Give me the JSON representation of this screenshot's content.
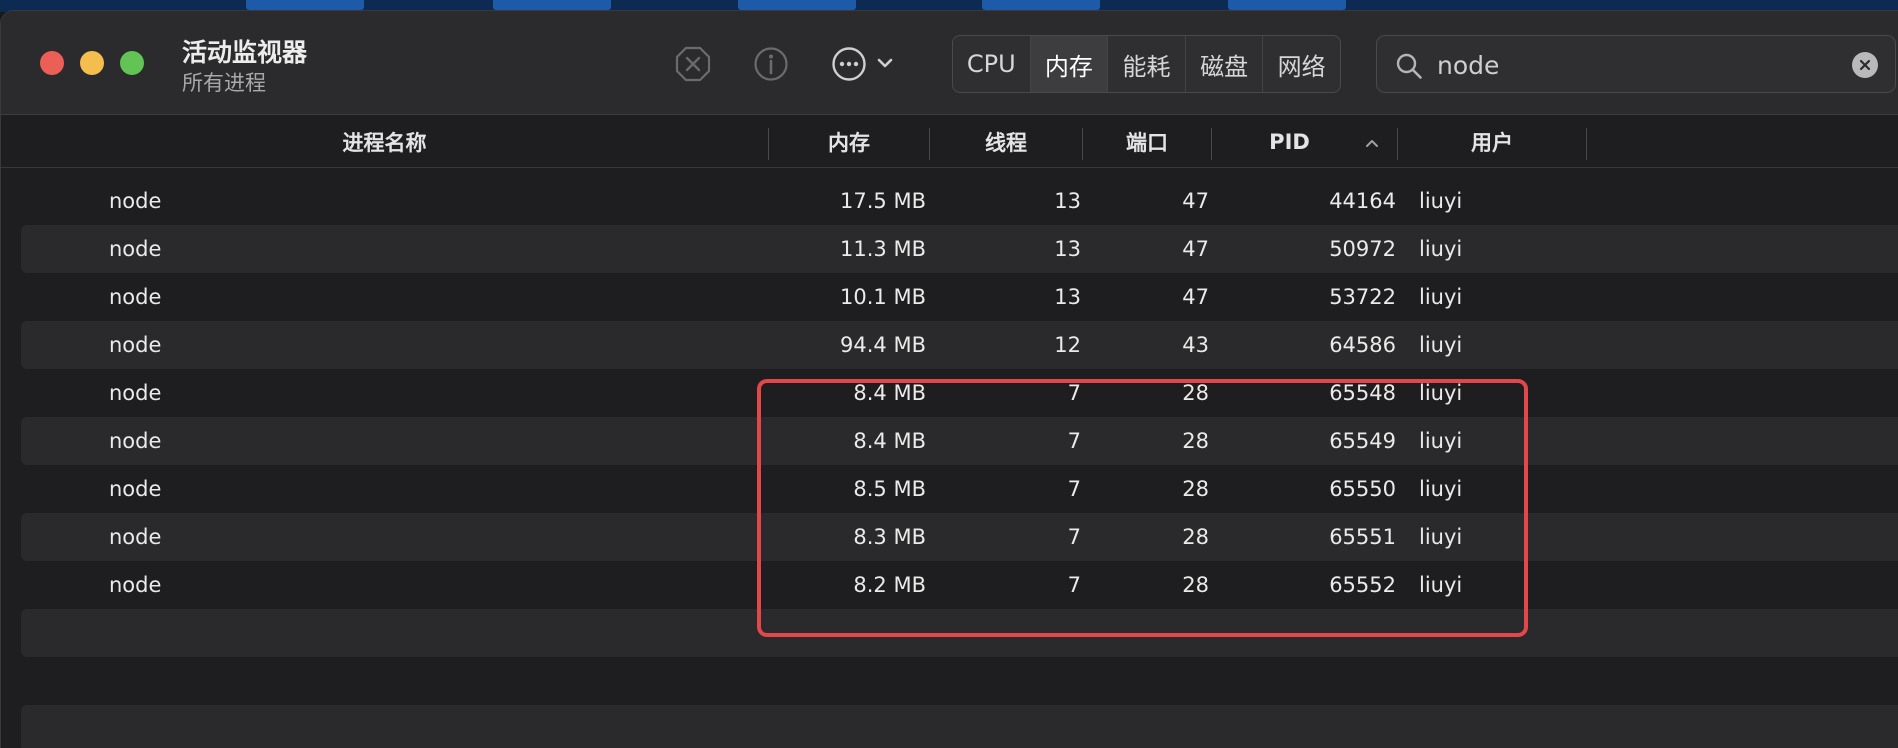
{
  "window": {
    "title": "活动监视器",
    "subtitle": "所有进程"
  },
  "toolbar": {
    "tabs": [
      {
        "label": "CPU"
      },
      {
        "label": "内存"
      },
      {
        "label": "能耗"
      },
      {
        "label": "磁盘"
      },
      {
        "label": "网络"
      }
    ],
    "active_tab": "内存",
    "search_value": "node"
  },
  "table": {
    "columns": [
      "进程名称",
      "内存",
      "线程",
      "端口",
      "PID",
      "用户"
    ],
    "sort_column": "PID",
    "sort_direction": "ascending",
    "rows": [
      {
        "name": "node",
        "memory": "17.5 MB",
        "threads": "13",
        "ports": "47",
        "pid": "44164",
        "user": "liuyi"
      },
      {
        "name": "node",
        "memory": "11.3 MB",
        "threads": "13",
        "ports": "47",
        "pid": "50972",
        "user": "liuyi"
      },
      {
        "name": "node",
        "memory": "10.1 MB",
        "threads": "13",
        "ports": "47",
        "pid": "53722",
        "user": "liuyi"
      },
      {
        "name": "node",
        "memory": "94.4 MB",
        "threads": "12",
        "ports": "43",
        "pid": "64586",
        "user": "liuyi"
      },
      {
        "name": "node",
        "memory": "8.4 MB",
        "threads": "7",
        "ports": "28",
        "pid": "65548",
        "user": "liuyi"
      },
      {
        "name": "node",
        "memory": "8.4 MB",
        "threads": "7",
        "ports": "28",
        "pid": "65549",
        "user": "liuyi"
      },
      {
        "name": "node",
        "memory": "8.5 MB",
        "threads": "7",
        "ports": "28",
        "pid": "65550",
        "user": "liuyi"
      },
      {
        "name": "node",
        "memory": "8.3 MB",
        "threads": "7",
        "ports": "28",
        "pid": "65551",
        "user": "liuyi"
      },
      {
        "name": "node",
        "memory": "8.2 MB",
        "threads": "7",
        "ports": "28",
        "pid": "65552",
        "user": "liuyi"
      }
    ]
  },
  "colors": {
    "highlight": "#e2474b",
    "close": "#ec5f57",
    "minimize": "#f4be4f",
    "zoom": "#61c454"
  },
  "icons": [
    "stop-process-icon",
    "info-icon",
    "more-actions-icon",
    "chevron-down-icon",
    "search-icon",
    "clear-search-icon",
    "sort-ascending-icon"
  ]
}
